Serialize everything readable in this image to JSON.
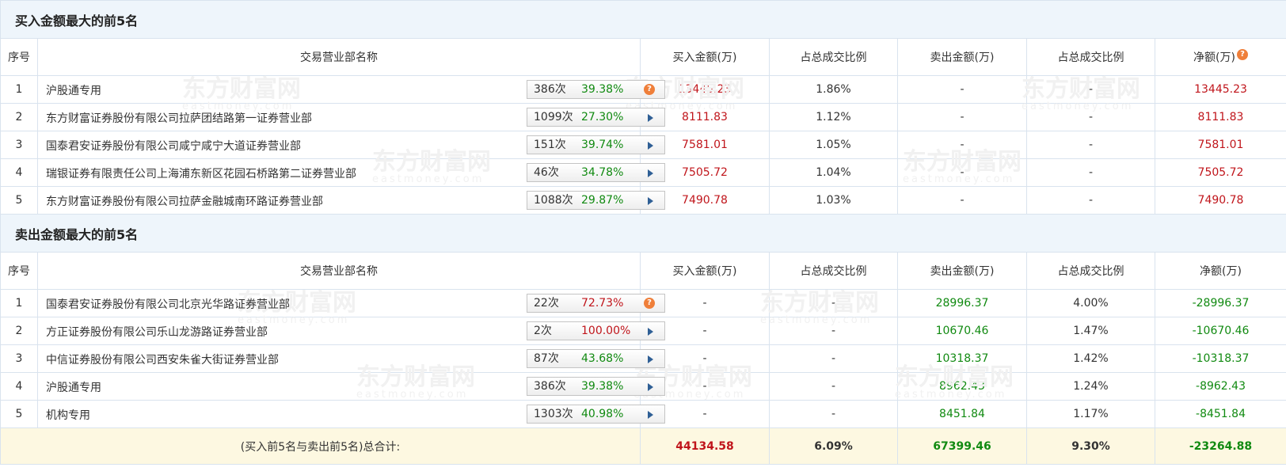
{
  "buy_section": {
    "title": "买入金额最大的前5名",
    "headers": [
      "序号",
      "交易营业部名称",
      "买入金额(万)",
      "占总成交比例",
      "卖出金额(万)",
      "占总成交比例",
      "净额(万)"
    ],
    "rows": [
      {
        "idx": "1",
        "name": "沪股通专用",
        "count": "386次",
        "pct": "39.38%",
        "buy": "13445.23",
        "buy_ratio": "1.86%",
        "sell": "-",
        "sell_ratio": "-",
        "net": "13445.23"
      },
      {
        "idx": "2",
        "name": "东方财富证券股份有限公司拉萨团结路第一证券营业部",
        "count": "1099次",
        "pct": "27.30%",
        "buy": "8111.83",
        "buy_ratio": "1.12%",
        "sell": "-",
        "sell_ratio": "-",
        "net": "8111.83"
      },
      {
        "idx": "3",
        "name": "国泰君安证券股份有限公司咸宁咸宁大道证券营业部",
        "count": "151次",
        "pct": "39.74%",
        "buy": "7581.01",
        "buy_ratio": "1.05%",
        "sell": "-",
        "sell_ratio": "-",
        "net": "7581.01"
      },
      {
        "idx": "4",
        "name": "瑞银证券有限责任公司上海浦东新区花园石桥路第二证券营业部",
        "count": "46次",
        "pct": "34.78%",
        "buy": "7505.72",
        "buy_ratio": "1.04%",
        "sell": "-",
        "sell_ratio": "-",
        "net": "7505.72"
      },
      {
        "idx": "5",
        "name": "东方财富证券股份有限公司拉萨金融城南环路证券营业部",
        "count": "1088次",
        "pct": "29.87%",
        "buy": "7490.78",
        "buy_ratio": "1.03%",
        "sell": "-",
        "sell_ratio": "-",
        "net": "7490.78"
      }
    ]
  },
  "sell_section": {
    "title": "卖出金额最大的前5名",
    "headers": [
      "序号",
      "交易营业部名称",
      "买入金额(万)",
      "占总成交比例",
      "卖出金额(万)",
      "占总成交比例",
      "净额(万)"
    ],
    "rows": [
      {
        "idx": "1",
        "name": "国泰君安证券股份有限公司北京光华路证券营业部",
        "count": "22次",
        "pct": "72.73%",
        "buy": "-",
        "buy_ratio": "-",
        "sell": "28996.37",
        "sell_ratio": "4.00%",
        "net": "-28996.37"
      },
      {
        "idx": "2",
        "name": "方正证券股份有限公司乐山龙游路证券营业部",
        "count": "2次",
        "pct": "100.00%",
        "buy": "-",
        "buy_ratio": "-",
        "sell": "10670.46",
        "sell_ratio": "1.47%",
        "net": "-10670.46"
      },
      {
        "idx": "3",
        "name": "中信证券股份有限公司西安朱雀大街证券营业部",
        "count": "87次",
        "pct": "43.68%",
        "buy": "-",
        "buy_ratio": "-",
        "sell": "10318.37",
        "sell_ratio": "1.42%",
        "net": "-10318.37"
      },
      {
        "idx": "4",
        "name": "沪股通专用",
        "count": "386次",
        "pct": "39.38%",
        "buy": "-",
        "buy_ratio": "-",
        "sell": "8962.43",
        "sell_ratio": "1.24%",
        "net": "-8962.43"
      },
      {
        "idx": "5",
        "name": "机构专用",
        "count": "1303次",
        "pct": "40.98%",
        "buy": "-",
        "buy_ratio": "-",
        "sell": "8451.84",
        "sell_ratio": "1.17%",
        "net": "-8451.84"
      }
    ]
  },
  "total": {
    "label": "(买入前5名与卖出前5名)总合计:",
    "buy": "44134.58",
    "buy_ratio": "6.09%",
    "sell": "67399.46",
    "sell_ratio": "9.30%",
    "net": "-23264.88"
  },
  "watermark": {
    "cn": "东方财富网",
    "en": "eastmoney.com"
  },
  "icons": {
    "help": "?"
  },
  "colors": {
    "red": "#c0151b",
    "green": "#118a11",
    "section_bg": "#eef5fb",
    "total_bg": "#fdf8e1",
    "border": "#d9e3ee"
  }
}
